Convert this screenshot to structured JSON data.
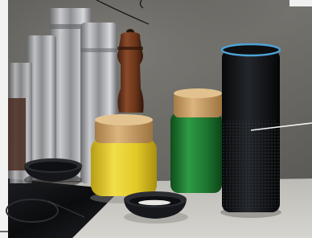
{
  "scene": {
    "kind": "kitchen-counter-photo",
    "palette": {
      "wall": "#6b6a66",
      "counter": "#c9c7c2",
      "cooktop": "#111215",
      "speaker_ring": "#4da3d6",
      "yellow_jar": "#e6cf2c",
      "green_jar": "#1f7a32",
      "wood_lid": "#c9a06b"
    }
  }
}
